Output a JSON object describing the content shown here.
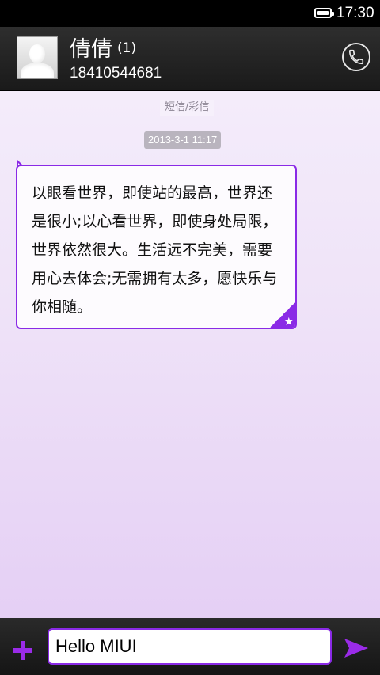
{
  "status_bar": {
    "time": "17:30",
    "icon": "battery-icon"
  },
  "header": {
    "contact_name": "倩倩",
    "unread_count": "(1)",
    "phone_number": "18410544681",
    "avatar_icon": "avatar-icon",
    "call_icon": "phone-icon"
  },
  "thread": {
    "divider_label": "短信/彩信",
    "timestamp": "2013-3-1 11:17",
    "messages": [
      {
        "text": "以眼看世界，即使站的最高，世界还是很小;以心看世界，即使身处局限，世界依然很大。生活远不完美，需要用心去体会;无需拥有太多，愿快乐与你相随。",
        "starred": true,
        "star_icon": "star-icon"
      }
    ]
  },
  "composer": {
    "input_value": "Hello MIUI",
    "add_icon": "plus-icon",
    "send_icon": "send-icon"
  },
  "colors": {
    "accent": "#8a2ae6",
    "header_bg": "#232323",
    "thread_bg_top": "#f6f0fb",
    "thread_bg_bottom": "#e3ccf4"
  }
}
